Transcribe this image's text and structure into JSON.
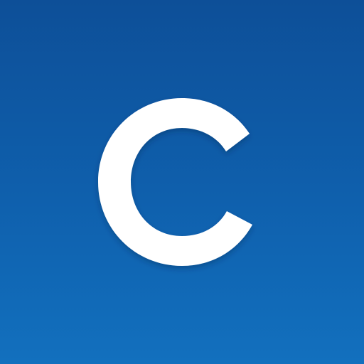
{
  "icon": {
    "name": "app-logo-icon",
    "colors": {
      "background_top": "#0d4f98",
      "background_mid": "#0f60ad",
      "background_bottom": "#1270be",
      "glyph": "#ffffff"
    },
    "glyph_letter": "C"
  }
}
